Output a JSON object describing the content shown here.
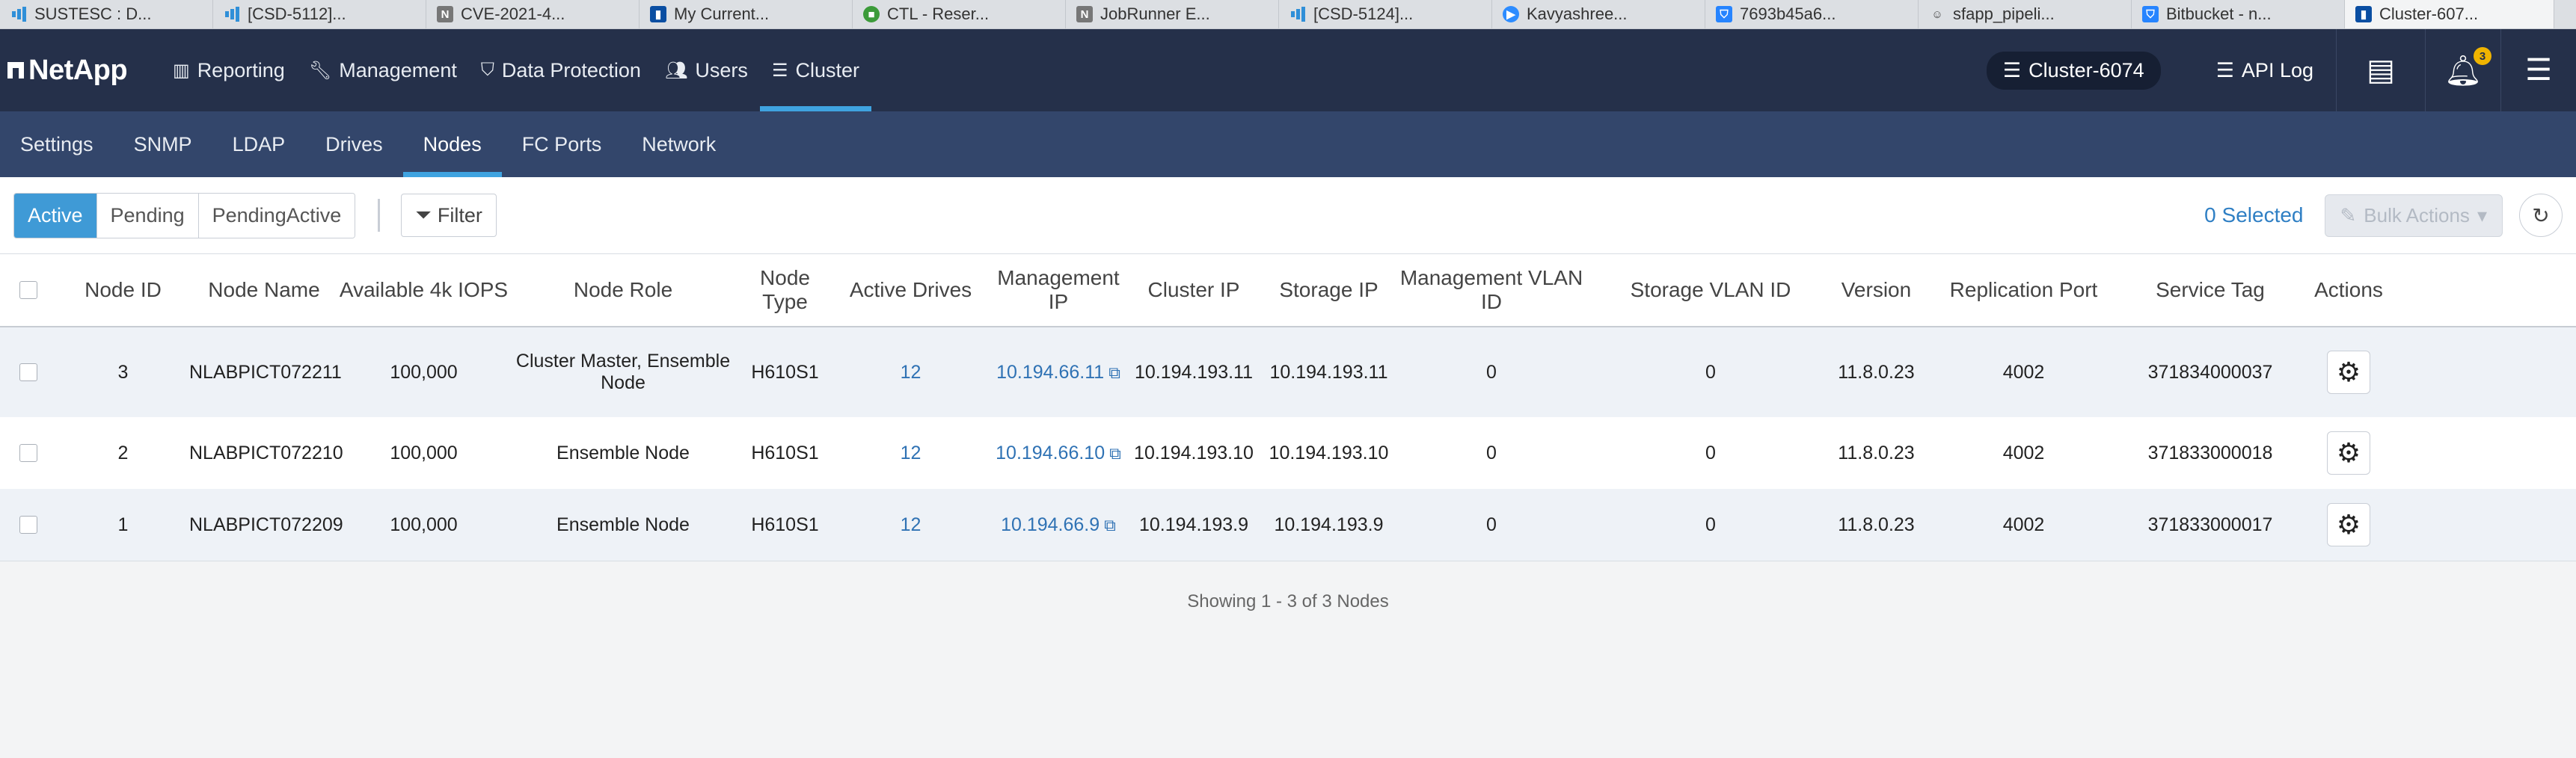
{
  "browser_tabs": [
    {
      "label": "SUSTESC : D...",
      "icon": "bar-chart-icon"
    },
    {
      "label": "[CSD-5112]...",
      "icon": "bar-chart-icon"
    },
    {
      "label": "CVE-2021-4...",
      "icon": "n-icon"
    },
    {
      "label": "My Current...",
      "icon": "app-icon"
    },
    {
      "label": "CTL - Reser...",
      "icon": "cube-icon"
    },
    {
      "label": "JobRunner E...",
      "icon": "n-icon"
    },
    {
      "label": "[CSD-5124]...",
      "icon": "bar-chart-icon"
    },
    {
      "label": "Kavyashree...",
      "icon": "zoom-icon"
    },
    {
      "label": "7693b45a6...",
      "icon": "bitbucket-icon"
    },
    {
      "label": "sfapp_pipeli...",
      "icon": "jenkins-icon"
    },
    {
      "label": "Bitbucket - n...",
      "icon": "bitbucket-icon"
    },
    {
      "label": "Cluster-607...",
      "icon": "app-icon"
    }
  ],
  "brand": "NetApp",
  "nav": {
    "items": [
      "Reporting",
      "Management",
      "Data Protection",
      "Users",
      "Cluster"
    ],
    "active": "Cluster",
    "cluster_name": "Cluster-6074",
    "api_log": "API Log",
    "notification_count": "3"
  },
  "subnav": {
    "items": [
      "Settings",
      "SNMP",
      "LDAP",
      "Drives",
      "Nodes",
      "FC Ports",
      "Network"
    ],
    "active": "Nodes"
  },
  "toolbar": {
    "filters": [
      "Active",
      "Pending",
      "PendingActive"
    ],
    "active_filter": "Active",
    "filter_label": "Filter",
    "selected_text": "0 Selected",
    "bulk_actions": "Bulk Actions"
  },
  "table": {
    "columns": [
      "Node ID",
      "Node Name",
      "Available 4k IOPS",
      "Node Role",
      "Node Type",
      "Active Drives",
      "Management IP",
      "Cluster IP",
      "Storage IP",
      "Management VLAN ID",
      "Storage VLAN ID",
      "Version",
      "Replication Port",
      "Service Tag",
      "Actions"
    ],
    "rows": [
      {
        "node_id": "3",
        "node_name": "NLABPICT072211",
        "iops": "100,000",
        "role_line1": "Cluster Master, Ensemble",
        "role_line2": "Node",
        "type": "H610S1",
        "drives": "12",
        "mgmt_ip": "10.194.66.11",
        "cluster_ip": "10.194.193.11",
        "storage_ip": "10.194.193.11",
        "mgmt_vlan": "0",
        "storage_vlan": "0",
        "version": "11.8.0.23",
        "rep_port": "4002",
        "service_tag": "371834000037"
      },
      {
        "node_id": "2",
        "node_name": "NLABPICT072210",
        "iops": "100,000",
        "role_line1": "Ensemble Node",
        "role_line2": "",
        "type": "H610S1",
        "drives": "12",
        "mgmt_ip": "10.194.66.10",
        "cluster_ip": "10.194.193.10",
        "storage_ip": "10.194.193.10",
        "mgmt_vlan": "0",
        "storage_vlan": "0",
        "version": "11.8.0.23",
        "rep_port": "4002",
        "service_tag": "371833000018"
      },
      {
        "node_id": "1",
        "node_name": "NLABPICT072209",
        "iops": "100,000",
        "role_line1": "Ensemble Node",
        "role_line2": "",
        "type": "H610S1",
        "drives": "12",
        "mgmt_ip": "10.194.66.9",
        "cluster_ip": "10.194.193.9",
        "storage_ip": "10.194.193.9",
        "mgmt_vlan": "0",
        "storage_vlan": "0",
        "version": "11.8.0.23",
        "rep_port": "4002",
        "service_tag": "371833000017"
      }
    ],
    "footer": "Showing 1 - 3 of 3 Nodes"
  }
}
